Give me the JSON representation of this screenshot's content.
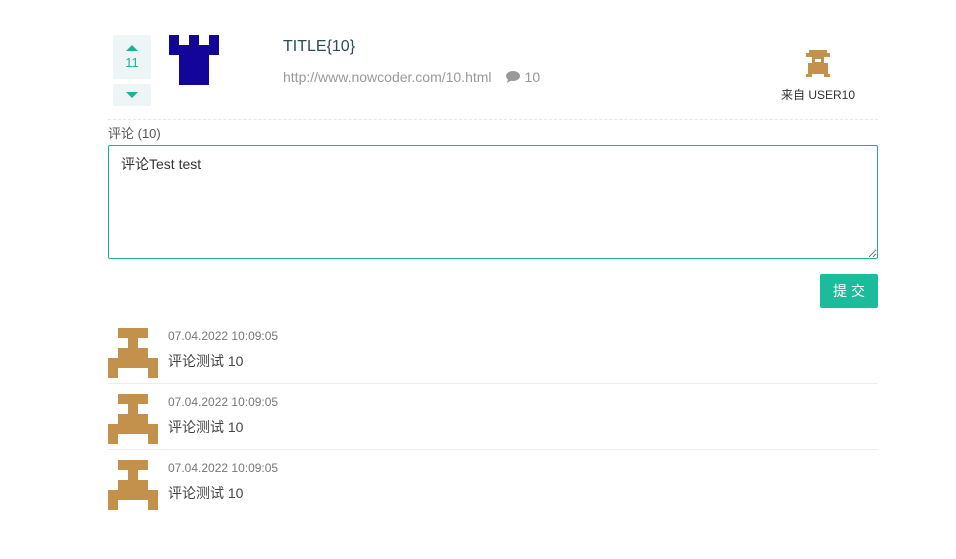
{
  "news": {
    "vote_count": "11",
    "title": "TITLE{10}",
    "link": "http://www.nowcoder.com/10.html",
    "comment_count": "10",
    "from_label": "来自 USER10"
  },
  "comments_section": {
    "header": "评论 (10)",
    "input_value": "评论Test test",
    "submit_label": "提交"
  },
  "comments": [
    {
      "time": "07.04.2022 10:09:05",
      "text": "评论测试 10"
    },
    {
      "time": "07.04.2022 10:09:05",
      "text": "评论测试 10"
    },
    {
      "time": "07.04.2022 10:09:05",
      "text": "评论测试 10"
    }
  ],
  "colors": {
    "accent": "#1bb394",
    "news_image": "#14059a",
    "avatar": "#c4914c"
  }
}
